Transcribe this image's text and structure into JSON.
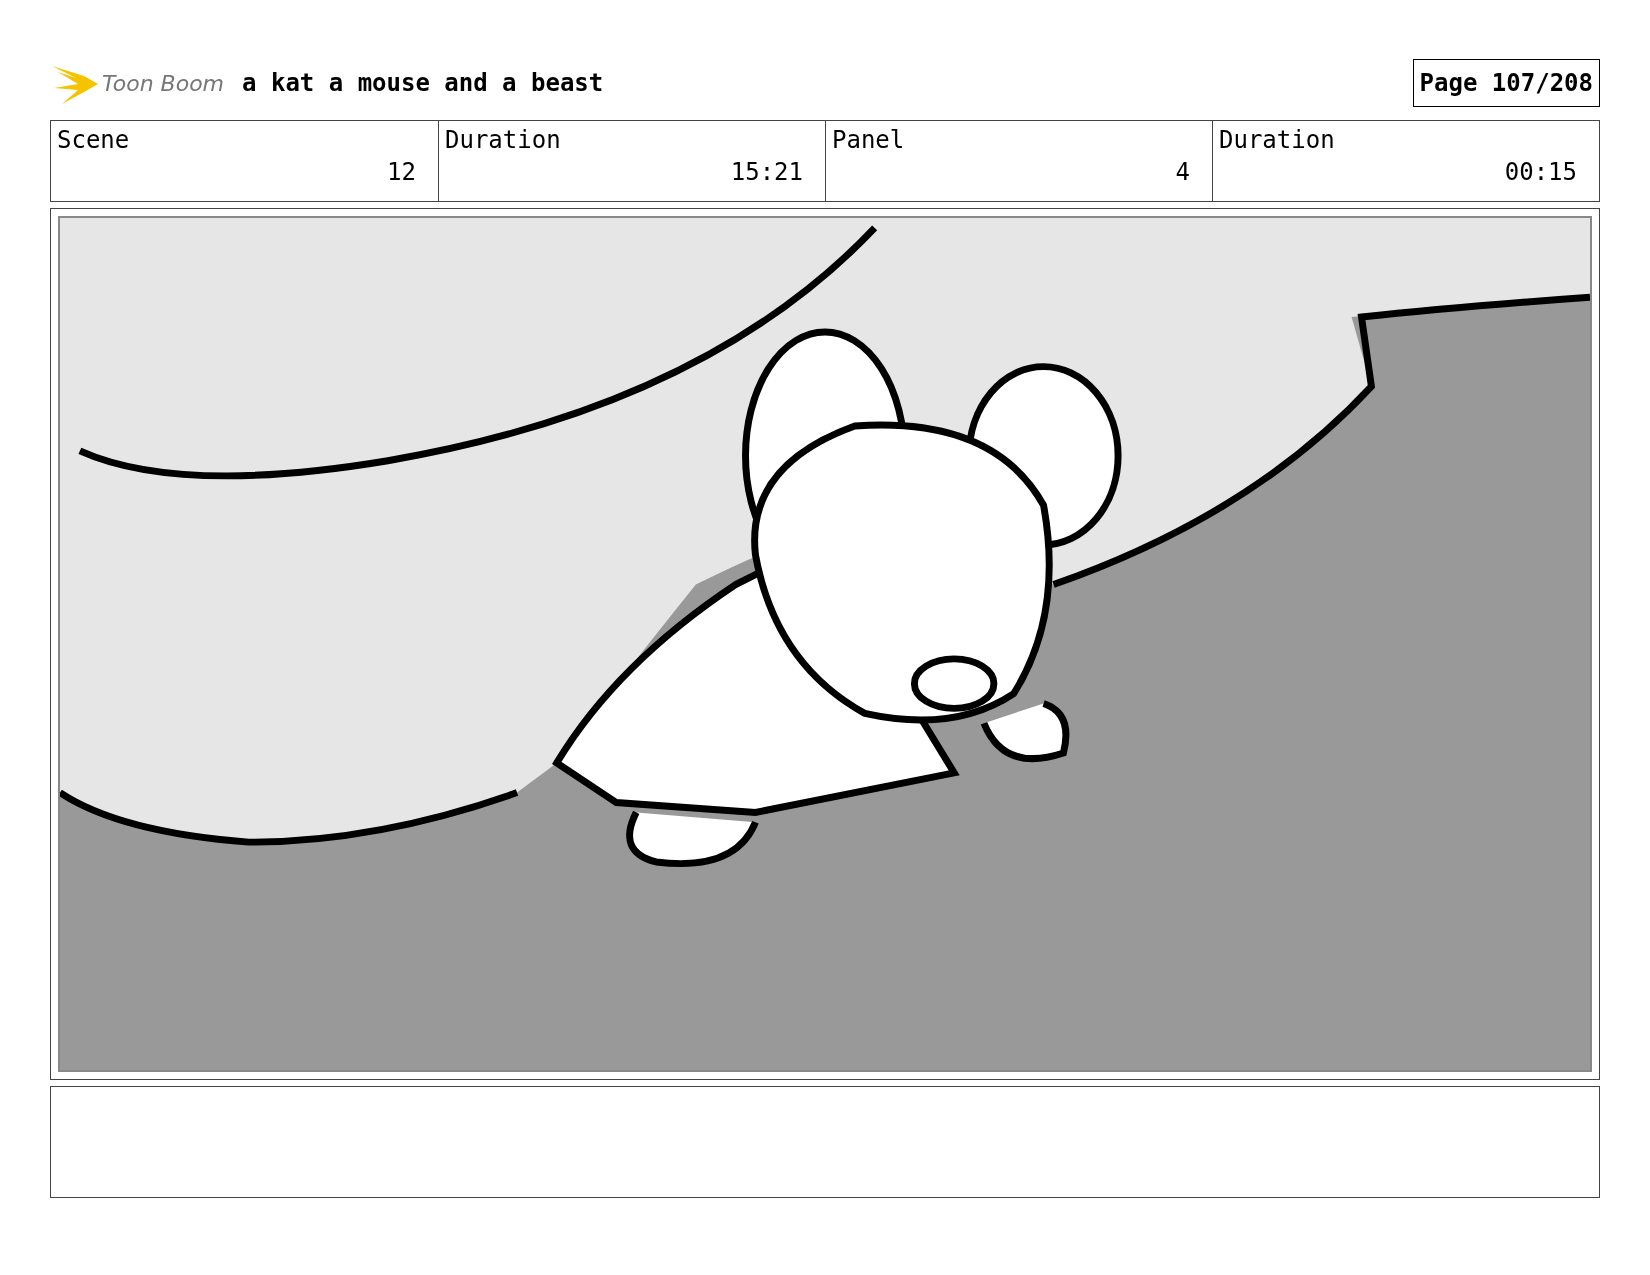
{
  "header": {
    "brand": "Toon Boom",
    "title": "a kat a mouse and a beast",
    "page": "Page 107/208"
  },
  "info": [
    {
      "label": "Scene",
      "value": "12"
    },
    {
      "label": "Duration",
      "value": "15:21"
    },
    {
      "label": "Panel",
      "value": "4"
    },
    {
      "label": "Duration",
      "value": "00:15"
    }
  ]
}
